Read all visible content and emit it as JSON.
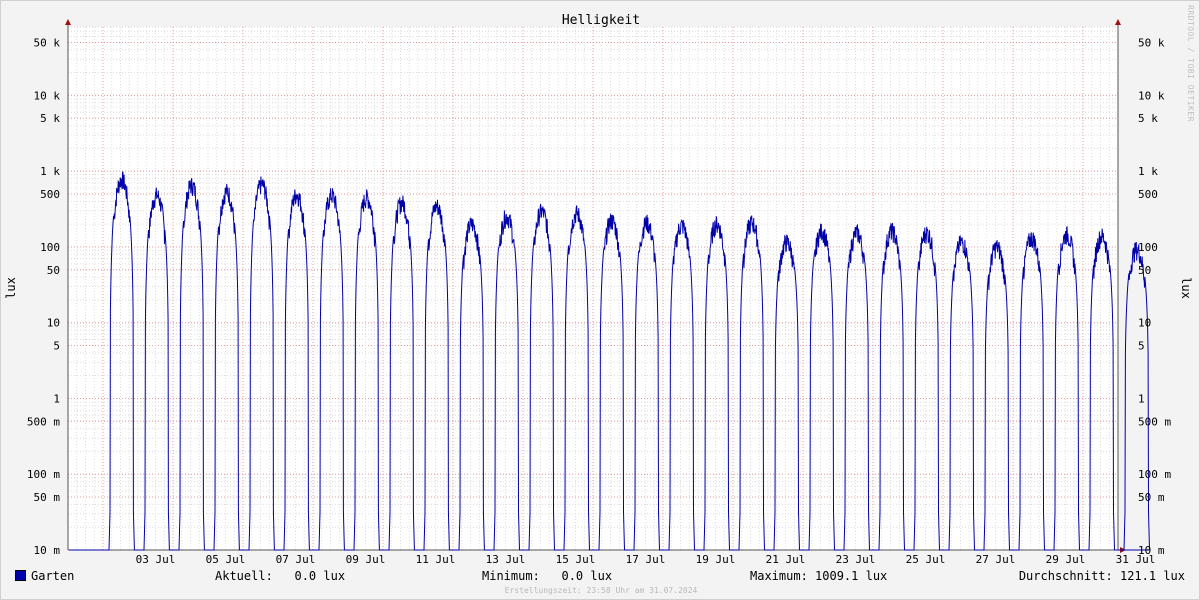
{
  "chart_data": {
    "type": "line",
    "title": "Helligkeit",
    "ylabel_left": "lux",
    "ylabel_right": "lux",
    "y_scale": "log",
    "ylim": [
      10,
      80000
    ],
    "xlim": [
      "2024-07-01T12:00",
      "2024-08-01T00:00"
    ],
    "y_ticks": [
      {
        "value": 10,
        "label": "10 k",
        "major": true,
        "mult": 1000
      },
      {
        "value": 50,
        "label": "50 k",
        "major": false,
        "mult": 1000
      },
      {
        "value": 10,
        "label": "10 k",
        "major": true,
        "mult": 1000
      }
    ],
    "y_tick_labels": [
      {
        "value": 50000,
        "label": "50 k"
      },
      {
        "value": 10000,
        "label": "10 k"
      },
      {
        "value": 5000,
        "label": "5 k"
      },
      {
        "value": 1000,
        "label": "1 k"
      },
      {
        "value": 500,
        "label": "500"
      },
      {
        "value": 100,
        "label": "100"
      },
      {
        "value": 50,
        "label": "50"
      },
      {
        "value": 10,
        "label": "10"
      },
      {
        "value": 5,
        "label": "5"
      },
      {
        "value": 1,
        "label": "1"
      },
      {
        "value": 0.5,
        "label": "500 m"
      },
      {
        "value": 0.1,
        "label": "100 m"
      },
      {
        "value": 0.05,
        "label": "50 m"
      },
      {
        "value": 0.01,
        "label": "10 m"
      }
    ],
    "x_tick_labels": [
      "03 Jul",
      "05 Jul",
      "07 Jul",
      "09 Jul",
      "11 Jul",
      "13 Jul",
      "15 Jul",
      "17 Jul",
      "19 Jul",
      "21 Jul",
      "23 Jul",
      "25 Jul",
      "27 Jul",
      "29 Jul",
      "31 Jul"
    ],
    "x_tick_days": [
      3,
      5,
      7,
      9,
      11,
      13,
      15,
      17,
      19,
      21,
      23,
      25,
      27,
      29,
      31
    ],
    "series": [
      {
        "name": "Garten",
        "color": "#0000a8",
        "daily_peak_lux": [
          {
            "day": "2024-07-02",
            "peak": 1009
          },
          {
            "day": "2024-07-03",
            "peak": 620
          },
          {
            "day": "2024-07-04",
            "peak": 850
          },
          {
            "day": "2024-07-05",
            "peak": 700
          },
          {
            "day": "2024-07-06",
            "peak": 870
          },
          {
            "day": "2024-07-07",
            "peak": 640
          },
          {
            "day": "2024-07-08",
            "peak": 620
          },
          {
            "day": "2024-07-09",
            "peak": 580
          },
          {
            "day": "2024-07-10",
            "peak": 500
          },
          {
            "day": "2024-07-11",
            "peak": 450
          },
          {
            "day": "2024-07-12",
            "peak": 260
          },
          {
            "day": "2024-07-13",
            "peak": 330
          },
          {
            "day": "2024-07-14",
            "peak": 380
          },
          {
            "day": "2024-07-15",
            "peak": 360
          },
          {
            "day": "2024-07-16",
            "peak": 290
          },
          {
            "day": "2024-07-17",
            "peak": 270
          },
          {
            "day": "2024-07-18",
            "peak": 250
          },
          {
            "day": "2024-07-19",
            "peak": 260
          },
          {
            "day": "2024-07-20",
            "peak": 270
          },
          {
            "day": "2024-07-21",
            "peak": 150
          },
          {
            "day": "2024-07-22",
            "peak": 210
          },
          {
            "day": "2024-07-23",
            "peak": 200
          },
          {
            "day": "2024-07-24",
            "peak": 210
          },
          {
            "day": "2024-07-25",
            "peak": 200
          },
          {
            "day": "2024-07-26",
            "peak": 150
          },
          {
            "day": "2024-07-27",
            "peak": 130
          },
          {
            "day": "2024-07-28",
            "peak": 170
          },
          {
            "day": "2024-07-29",
            "peak": 190
          },
          {
            "day": "2024-07-30",
            "peak": 180
          },
          {
            "day": "2024-07-31",
            "peak": 120
          }
        ]
      }
    ],
    "grid": true,
    "legend_position": "bottom-left"
  },
  "legend": {
    "series_label": "Garten",
    "swatch_color": "#0000a8",
    "current": "Aktuell:   0.0 lux",
    "minimum": "Minimum:   0.0 lux",
    "maximum": "Maximum: 1009.1 lux",
    "average": "Durchschnitt: 121.1 lux"
  },
  "footer": {
    "timestamp": "Erstellungszeit: 23:58 Uhr am 31.07.2024"
  },
  "watermark": "RRDTOOL / TOBI OETIKER"
}
